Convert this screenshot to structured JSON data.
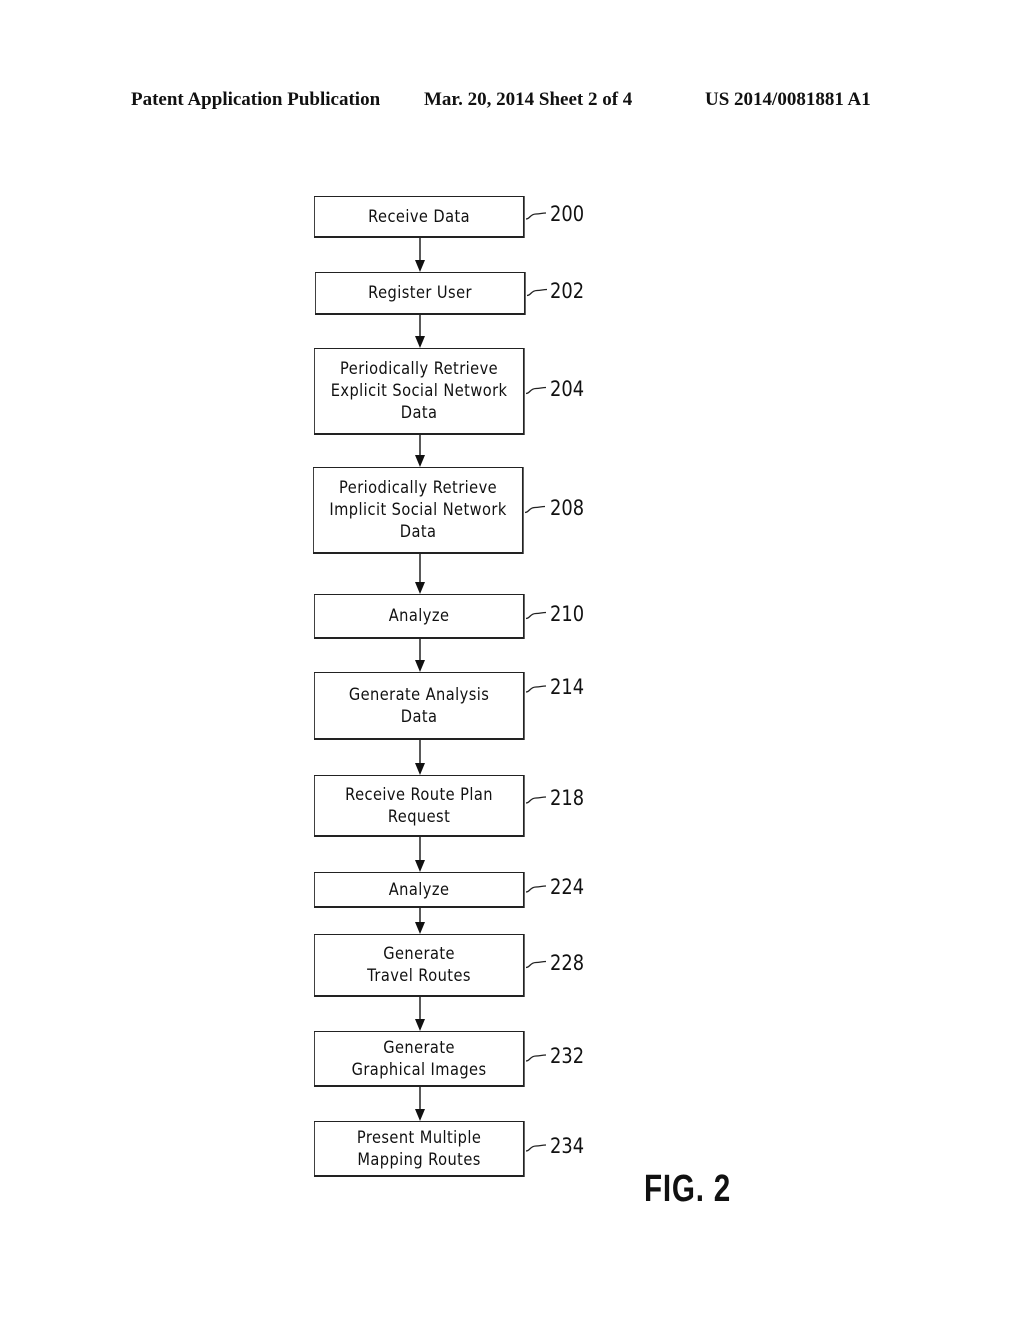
{
  "header": {
    "left": "Patent Application Publication",
    "middle": "Mar. 20, 2014  Sheet 2 of 4",
    "right": "US 2014/0081881 A1"
  },
  "flowchart": {
    "steps": [
      {
        "label": "Receive Data",
        "ref": "200"
      },
      {
        "label": "Register User",
        "ref": "202"
      },
      {
        "label": "Periodically Retrieve\nExplicit Social Network\nData",
        "ref": "204"
      },
      {
        "label": "Periodically Retrieve\nImplicit Social Network\nData",
        "ref": "208"
      },
      {
        "label": "Analyze",
        "ref": "210"
      },
      {
        "label": "Generate Analysis\nData",
        "ref": "214"
      },
      {
        "label": "Receive Route Plan\nRequest",
        "ref": "218"
      },
      {
        "label": "Analyze",
        "ref": "224"
      },
      {
        "label": "Generate\nTravel Routes",
        "ref": "228"
      },
      {
        "label": "Generate\nGraphical Images",
        "ref": "232"
      },
      {
        "label": "Present Multiple\nMapping Routes",
        "ref": "234"
      }
    ]
  },
  "figure_label": "FIG. 2"
}
